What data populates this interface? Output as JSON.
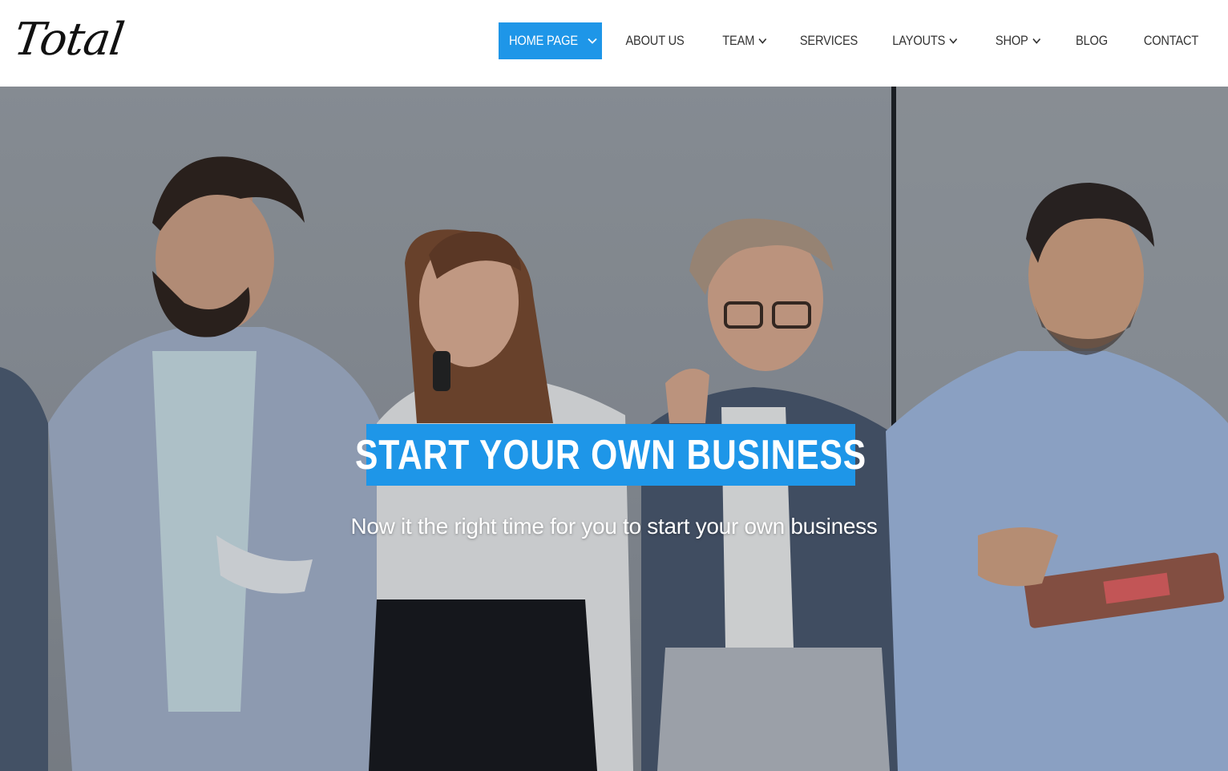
{
  "site": {
    "logo": "Total"
  },
  "nav": {
    "items": [
      {
        "label": "HOME PAGE",
        "active": true,
        "dropdown": true
      },
      {
        "label": "ABOUT US",
        "active": false,
        "dropdown": false
      },
      {
        "label": "TEAM",
        "active": false,
        "dropdown": true
      },
      {
        "label": "SERVICES",
        "active": false,
        "dropdown": false
      },
      {
        "label": "LAYOUTS",
        "active": false,
        "dropdown": true
      },
      {
        "label": "SHOP",
        "active": false,
        "dropdown": true
      },
      {
        "label": "BLOG",
        "active": false,
        "dropdown": false
      },
      {
        "label": "CONTACT",
        "active": false,
        "dropdown": false
      }
    ]
  },
  "hero": {
    "title": "START YOUR OWN BUSINESS",
    "subtitle": "Now it the right time for you to start your own business",
    "image": "business-team-photo"
  },
  "colors": {
    "accent": "#1e96e8",
    "nav_text": "#333333",
    "hero_text": "#ffffff"
  }
}
